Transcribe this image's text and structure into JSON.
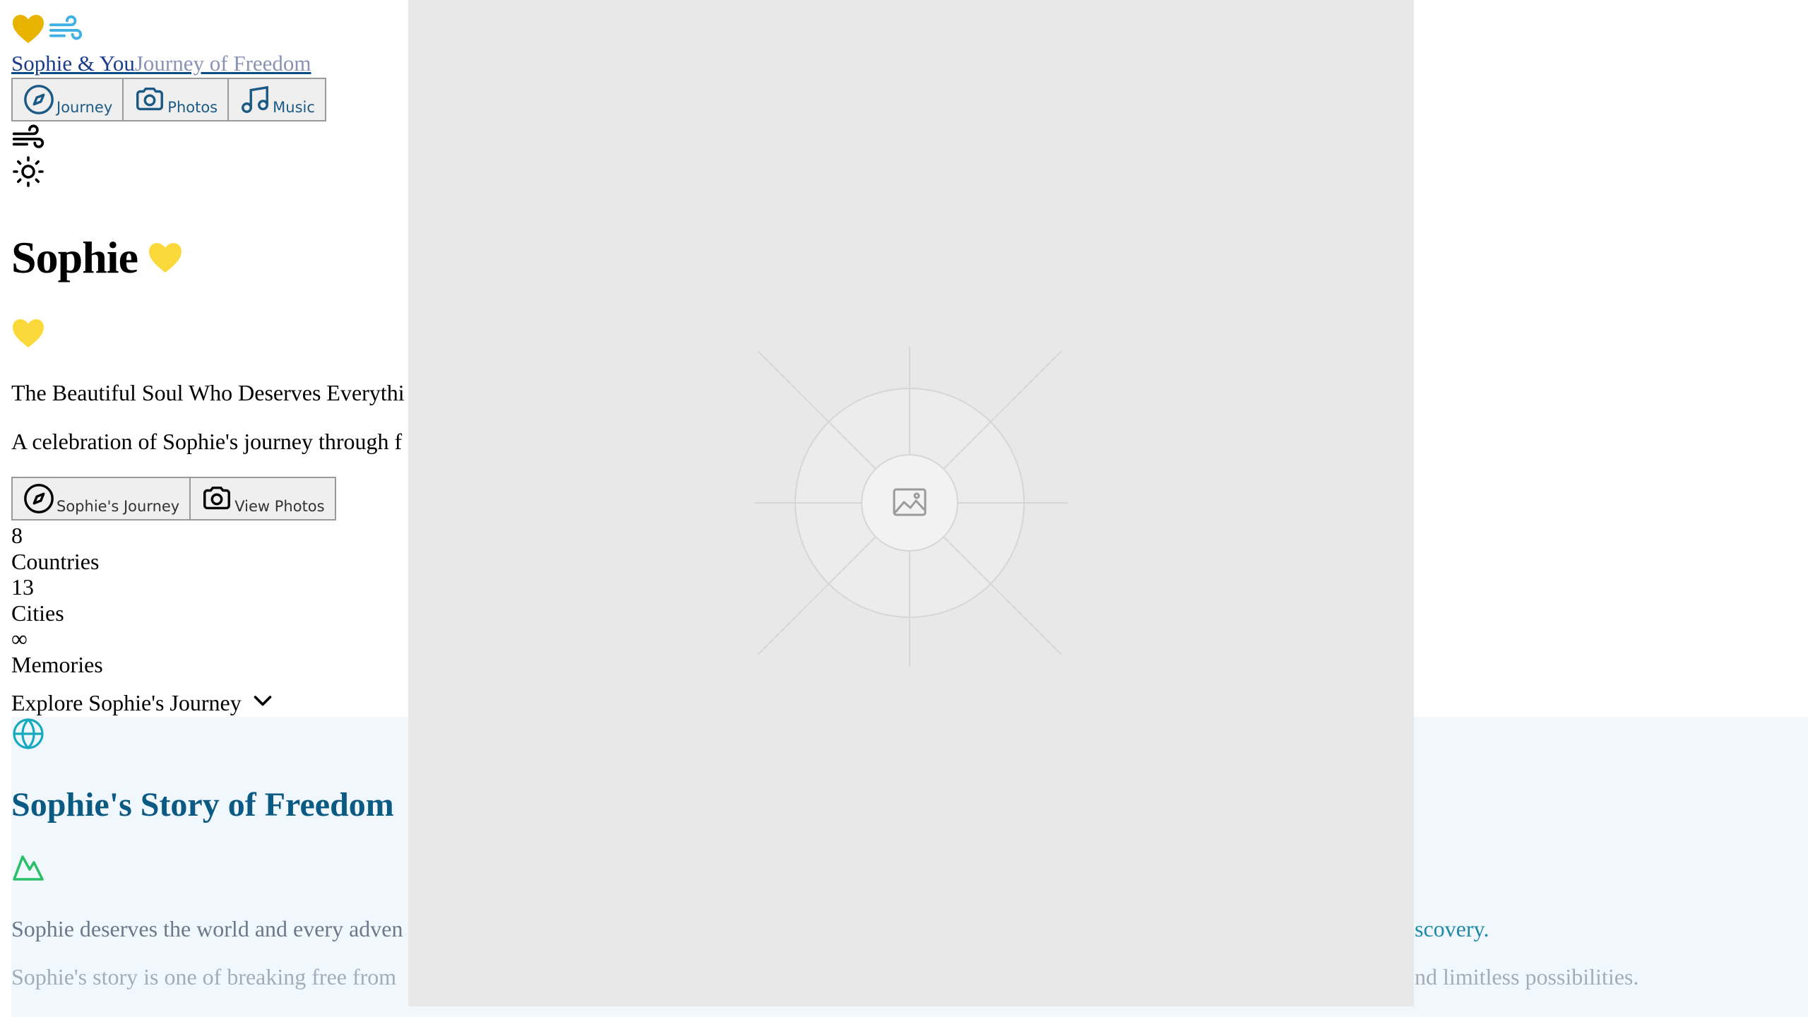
{
  "header": {
    "brand_name": "Sophie & You",
    "brand_tagline": "Journey of Freedom",
    "nav": [
      {
        "label": "Journey",
        "icon": "compass-icon"
      },
      {
        "label": "Photos",
        "icon": "camera-icon"
      },
      {
        "label": "Music",
        "icon": "music-note-icon"
      }
    ]
  },
  "hero": {
    "title": "Sophie",
    "subtitle": "The Beautiful Soul Who Deserves Everythi",
    "description": "A celebration of Sophie's journey through f",
    "actions": [
      {
        "label": "Sophie's Journey",
        "icon": "compass-icon"
      },
      {
        "label": "View Photos",
        "icon": "camera-icon"
      }
    ],
    "stats": [
      {
        "value": "8",
        "label": "Countries"
      },
      {
        "value": "13",
        "label": "Cities"
      },
      {
        "value": "∞",
        "label": "Memories"
      }
    ],
    "explore_label": "Explore Sophie's Journey"
  },
  "story": {
    "title": "Sophie's Story of Freedom",
    "p1_start": "Sophie deserves the world and every adven",
    "p1_end": "scovery.",
    "p2_start": "Sophie's story is one of breaking free from",
    "p2_end": "nd limitless possibilities."
  },
  "colors": {
    "heart_gold": "#e8b400",
    "heart_yellow": "#fcd93a",
    "wind_blue": "#3fb1e4",
    "accent_blue": "#0b5a84",
    "globe_teal": "#17aabf",
    "mountain_green": "#2bbf6a",
    "story_bg": "#f1f8fd",
    "placeholder_bg": "#e8e8e8"
  }
}
